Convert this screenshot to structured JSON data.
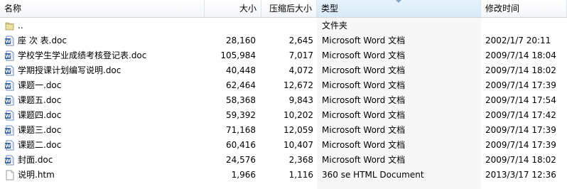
{
  "header": {
    "name": "名称",
    "size": "大小",
    "compressed": "压缩后大小",
    "type": "类型",
    "modified": "修改时间"
  },
  "rows": [
    {
      "name": "..",
      "size": "",
      "compressed": "",
      "type": "文件夹",
      "modified": "",
      "icon": "folder-icon"
    },
    {
      "name": "座  次  表.doc",
      "size": "28,160",
      "compressed": "2,645",
      "type": "Microsoft Word 文档",
      "modified": "2002/1/7 20:11",
      "icon": "word-doc-icon"
    },
    {
      "name": "学校学生学业成绩考核登记表.doc",
      "size": "105,984",
      "compressed": "7,017",
      "type": "Microsoft Word 文档",
      "modified": "2009/7/14 18:04",
      "icon": "word-doc-icon"
    },
    {
      "name": "学期授课计划编写说明.doc",
      "size": "40,448",
      "compressed": "4,072",
      "type": "Microsoft Word 文档",
      "modified": "2009/7/14 18:02",
      "icon": "word-doc-icon"
    },
    {
      "name": "课题一.doc",
      "size": "62,464",
      "compressed": "12,672",
      "type": "Microsoft Word 文档",
      "modified": "2009/7/14 17:39",
      "icon": "word-doc-icon"
    },
    {
      "name": "课题五.doc",
      "size": "58,368",
      "compressed": "9,843",
      "type": "Microsoft Word 文档",
      "modified": "2009/7/14 17:54",
      "icon": "word-doc-icon"
    },
    {
      "name": "课题四.doc",
      "size": "59,392",
      "compressed": "10,202",
      "type": "Microsoft Word 文档",
      "modified": "2009/7/14 17:42",
      "icon": "word-doc-icon"
    },
    {
      "name": "课题三.doc",
      "size": "71,168",
      "compressed": "12,059",
      "type": "Microsoft Word 文档",
      "modified": "2009/7/14 17:39",
      "icon": "word-doc-icon"
    },
    {
      "name": "课题二.doc",
      "size": "60,416",
      "compressed": "10,407",
      "type": "Microsoft Word 文档",
      "modified": "2009/7/14 17:39",
      "icon": "word-doc-icon"
    },
    {
      "name": "封面.doc",
      "size": "24,576",
      "compressed": "2,368",
      "type": "Microsoft Word 文档",
      "modified": "2009/7/14 18:02",
      "icon": "word-doc-icon"
    },
    {
      "name": "说明.htm",
      "size": "1,966",
      "compressed": "1,116",
      "type": "360 se HTML Document",
      "modified": "2013/3/17 12:36",
      "icon": "html-file-icon"
    }
  ]
}
